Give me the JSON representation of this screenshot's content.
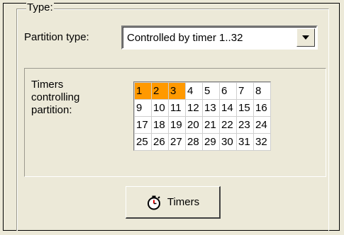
{
  "type_group": {
    "title": "Type:"
  },
  "partition_type": {
    "label": "Partition type:",
    "selected": "Controlled by timer 1..32",
    "arrow_icon": "dropdown-arrow-icon"
  },
  "timers": {
    "label": "Timers\ncontrolling\npartition:",
    "active_color": "#ff9900",
    "cells": [
      {
        "n": "1",
        "on": true
      },
      {
        "n": "2",
        "on": true
      },
      {
        "n": "3",
        "on": true
      },
      {
        "n": "4",
        "on": false
      },
      {
        "n": "5",
        "on": false
      },
      {
        "n": "6",
        "on": false
      },
      {
        "n": "7",
        "on": false
      },
      {
        "n": "8",
        "on": false
      },
      {
        "n": "9",
        "on": false
      },
      {
        "n": "10",
        "on": false
      },
      {
        "n": "11",
        "on": false
      },
      {
        "n": "12",
        "on": false
      },
      {
        "n": "13",
        "on": false
      },
      {
        "n": "14",
        "on": false
      },
      {
        "n": "15",
        "on": false
      },
      {
        "n": "16",
        "on": false
      },
      {
        "n": "17",
        "on": false
      },
      {
        "n": "18",
        "on": false
      },
      {
        "n": "19",
        "on": false
      },
      {
        "n": "20",
        "on": false
      },
      {
        "n": "21",
        "on": false
      },
      {
        "n": "22",
        "on": false
      },
      {
        "n": "23",
        "on": false
      },
      {
        "n": "24",
        "on": false
      },
      {
        "n": "25",
        "on": false
      },
      {
        "n": "26",
        "on": false
      },
      {
        "n": "27",
        "on": false
      },
      {
        "n": "28",
        "on": false
      },
      {
        "n": "29",
        "on": false
      },
      {
        "n": "30",
        "on": false
      },
      {
        "n": "31",
        "on": false
      },
      {
        "n": "32",
        "on": false
      }
    ]
  },
  "timers_button": {
    "label": "Timers",
    "icon": "stopwatch-icon"
  }
}
